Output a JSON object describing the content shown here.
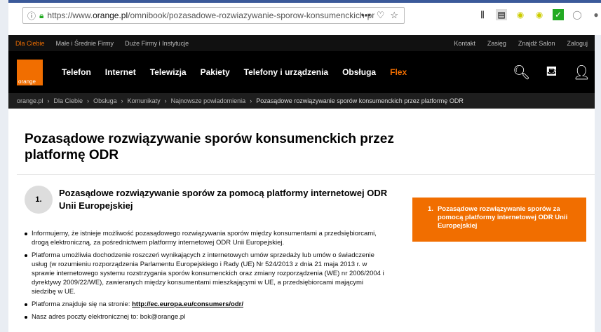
{
  "browser": {
    "url_prefix": "https://www.",
    "url_host": "orange.pl",
    "url_path": "/omnibook/pozasadowe-rozwiazywanie-sporow-konsumenckich-pr",
    "more": "•••"
  },
  "topnav": {
    "left": [
      "Dla Ciebie",
      "Małe i Średnie Firmy",
      "Duże Firmy i Instytucje"
    ],
    "right": [
      "Kontakt",
      "Zasięg",
      "Znajdź Salon",
      "Zaloguj"
    ]
  },
  "logo": "orange",
  "menu": [
    "Telefon",
    "Internet",
    "Telewizja",
    "Pakiety",
    "Telefony i urządzenia",
    "Obsługa",
    "Flex"
  ],
  "breadcrumb": [
    "orange.pl",
    "Dla Ciebie",
    "Obsługa",
    "Komunikaty",
    "Najnowsze powiadomienia",
    "Pozasądowe rozwiązywanie sporów konsumenckich przez platformę ODR"
  ],
  "title": "Pozasądowe rozwiązywanie sporów konsumenckich przez platformę ODR",
  "section": {
    "number": "1.",
    "title": "Pozasądowe rozwiązywanie sporów za pomocą platformy internetowej ODR Unii Europejskiej"
  },
  "bullets": [
    "Informujemy, że istnieje możliwość pozasądowego rozwiązywania sporów między konsumentami a przedsiębiorcami, drogą elektroniczną, za pośrednictwem platformy internetowej ODR Unii Europejskiej.",
    "Platforma umożliwia dochodzenie roszczeń wynikających z internetowych umów sprzedaży lub umów o świadczenie usług (w rozumieniu rozporządzenia Parlamentu Europejskiego i Rady (UE) Nr 524/2013 z dnia 21 maja 2013 r. w sprawie internetowego systemu rozstrzygania sporów konsumenckich oraz zmiany rozporządzenia (WE) nr 2006/2004 i dyrektywy 2009/22/WE), zawieranych między konsumentami mieszkającymi w UE, a przedsiębiorcami mającymi siedzibę w UE."
  ],
  "platform": {
    "label": "Platforma znajduje się na stronie: ",
    "link": "http://ec.europa.eu/consumers/odr/"
  },
  "email": "Nasz adres poczty elektronicznej to: bok@orange.pl",
  "sidebar": {
    "number": "1.",
    "label": "Pozasądowe rozwiązywanie sporów za pomocą platformy internetowej ODR Unii Europejskiej"
  },
  "colors": {
    "brand": "#f16e00"
  }
}
